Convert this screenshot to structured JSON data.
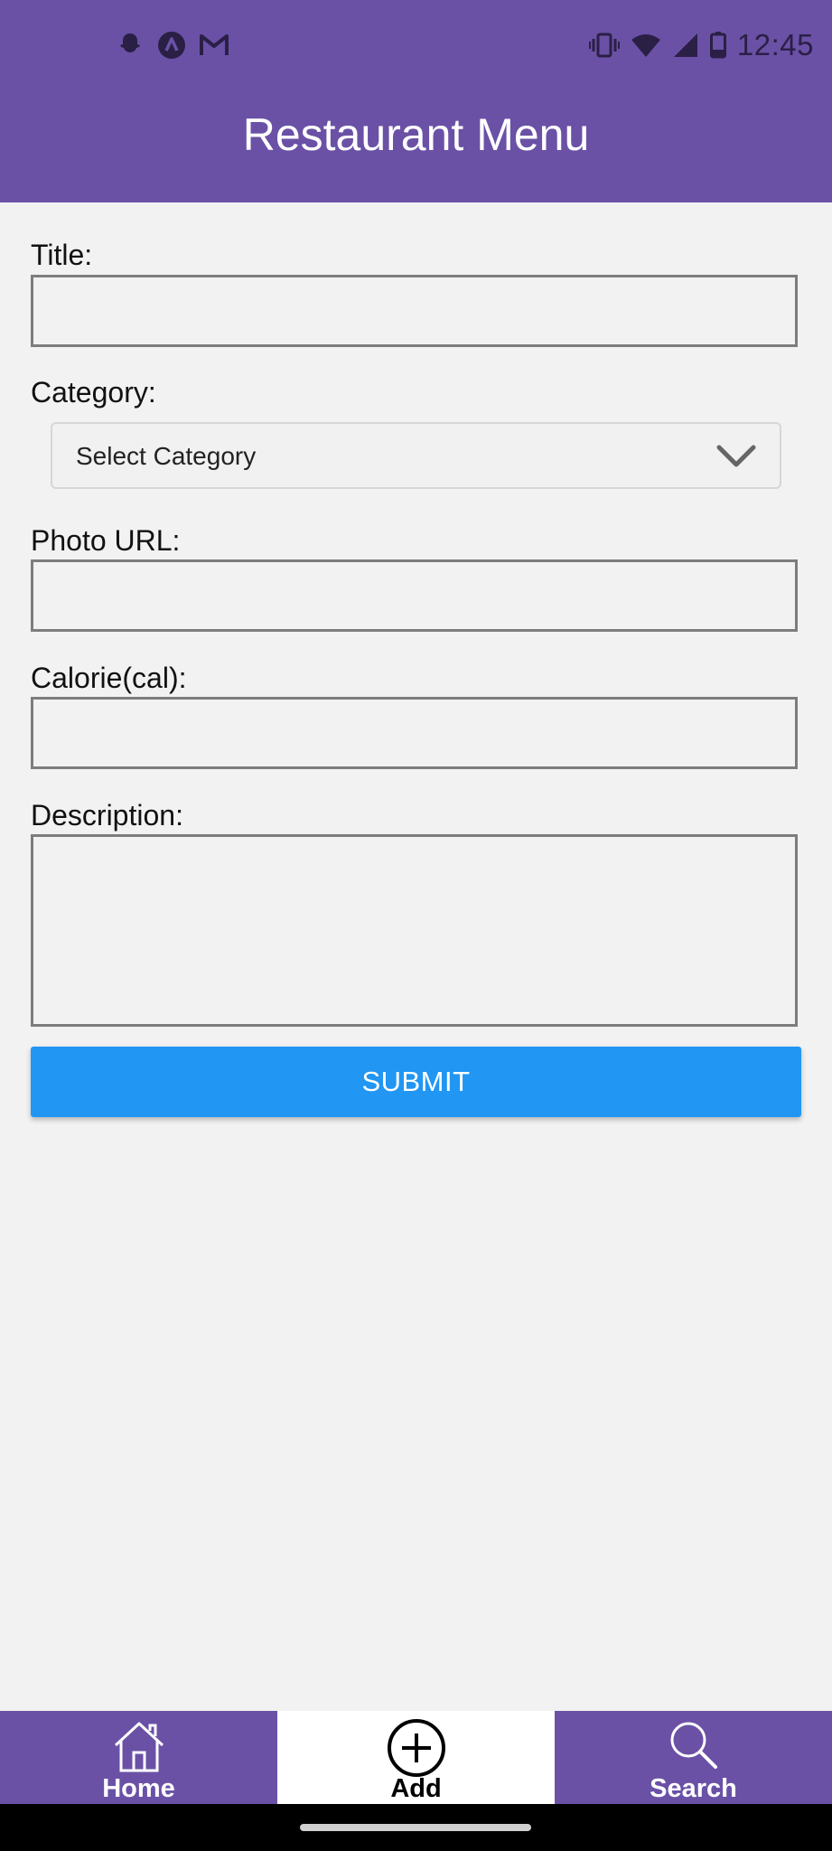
{
  "status_bar": {
    "time": "12:45",
    "left_icons": [
      "snapchat-icon",
      "app-a-icon",
      "gmail-icon"
    ],
    "right_icons": [
      "vibrate-icon",
      "wifi-icon",
      "signal-icon",
      "battery-icon"
    ]
  },
  "header": {
    "title": "Restaurant Menu",
    "background": "#6a51a6"
  },
  "form": {
    "title_label": "Title:",
    "title_value": "",
    "category_label": "Category:",
    "category_selected": "Select Category",
    "photo_label": "Photo URL:",
    "photo_value": "",
    "calorie_label": "Calorie(cal):",
    "calorie_value": "",
    "description_label": "Description:",
    "description_value": "",
    "submit_label": "SUBMIT",
    "submit_color": "#2196f3"
  },
  "bottom_nav": {
    "items": [
      {
        "label": "Home",
        "icon": "home-icon",
        "active": false
      },
      {
        "label": "Add",
        "icon": "add-circle-icon",
        "active": true
      },
      {
        "label": "Search",
        "icon": "search-icon",
        "active": false
      }
    ]
  }
}
